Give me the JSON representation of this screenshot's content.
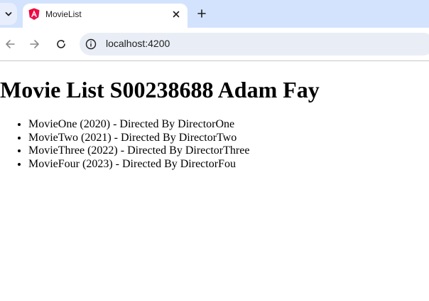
{
  "browser": {
    "tab": {
      "title": "MovieList",
      "favicon": "angular-icon"
    },
    "address_bar": {
      "url": "localhost:4200"
    },
    "colors": {
      "tabstrip": "#d3e3fd",
      "omnibox": "#e9eef6",
      "favicon_red": "#dd0031",
      "favicon_purple": "#c2185b"
    }
  },
  "page": {
    "heading": "Movie List S00238688 Adam Fay",
    "movies": [
      "MovieOne (2020) - Directed By DirectorOne",
      "MovieTwo (2021) - Directed By DirectorTwo",
      "MovieThree (2022) - Directed By DirectorThree",
      "MovieFour (2023) - Directed By DirectorFou"
    ]
  }
}
